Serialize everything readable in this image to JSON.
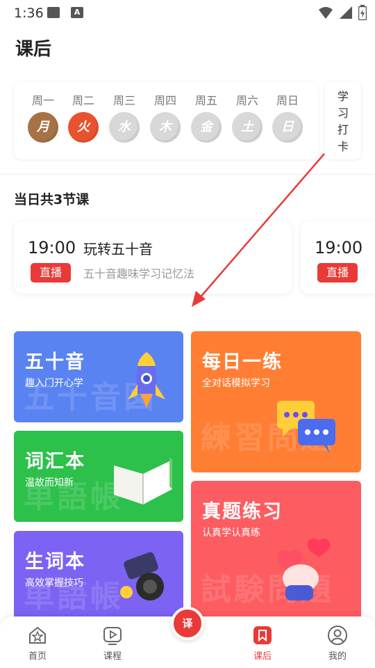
{
  "status": {
    "time": "1:36",
    "a_badge": "A"
  },
  "page": {
    "title": "课后"
  },
  "week": {
    "days": [
      {
        "label": "周一",
        "glyph": "月",
        "color": "#a67246"
      },
      {
        "label": "周二",
        "glyph": "火",
        "color": "#e8522e"
      },
      {
        "label": "周三",
        "glyph": "水",
        "color": "#d7d7d7"
      },
      {
        "label": "周四",
        "glyph": "木",
        "color": "#d7d7d7"
      },
      {
        "label": "周五",
        "glyph": "金",
        "color": "#d7d7d7"
      },
      {
        "label": "周六",
        "glyph": "土",
        "color": "#d7d7d7"
      },
      {
        "label": "周日",
        "glyph": "日",
        "color": "#d7d7d7"
      }
    ],
    "checkin": [
      "学",
      "习",
      "打",
      "卡"
    ]
  },
  "classes": {
    "count_title": "当日共3节课",
    "items": [
      {
        "time": "19:00",
        "tag": "直播",
        "name": "玩转五十音",
        "desc": "五十音趣味学习记忆法"
      },
      {
        "time": "19:00",
        "tag": "直播"
      }
    ]
  },
  "tiles": {
    "gojuon": {
      "title": "五十音",
      "subtitle": "趣入门开心学",
      "watermark": "五十音図",
      "color": "#5a83f2",
      "icon": "rocket-icon"
    },
    "vocab": {
      "title": "词汇本",
      "subtitle": "温故而知新",
      "watermark": "単語帳",
      "color": "#2dc04b",
      "icon": "book-icon"
    },
    "newwords": {
      "title": "生词本",
      "subtitle": "高效掌握技巧",
      "watermark": "単語帳",
      "color": "#7c63f3",
      "icon": "cannon-icon"
    },
    "daily": {
      "title": "每日一练",
      "subtitle": "全对话模拟学习",
      "watermark": "練習問題",
      "color": "#ff7e34",
      "icon": "chat-bubbles-icon"
    },
    "exam": {
      "title": "真题练习",
      "subtitle": "认真学认真练",
      "watermark": "試験問題",
      "color": "#fd5c60",
      "icon": "heart-hand-icon"
    }
  },
  "nav": {
    "items": [
      {
        "label": "首页",
        "icon": "home-icon"
      },
      {
        "label": "课程",
        "icon": "play-icon"
      },
      {
        "label": "课后",
        "icon": "bookmark-icon",
        "active": true
      },
      {
        "label": "我的",
        "icon": "user-icon"
      }
    ],
    "fab": "译"
  },
  "accent": "#ea3a37"
}
